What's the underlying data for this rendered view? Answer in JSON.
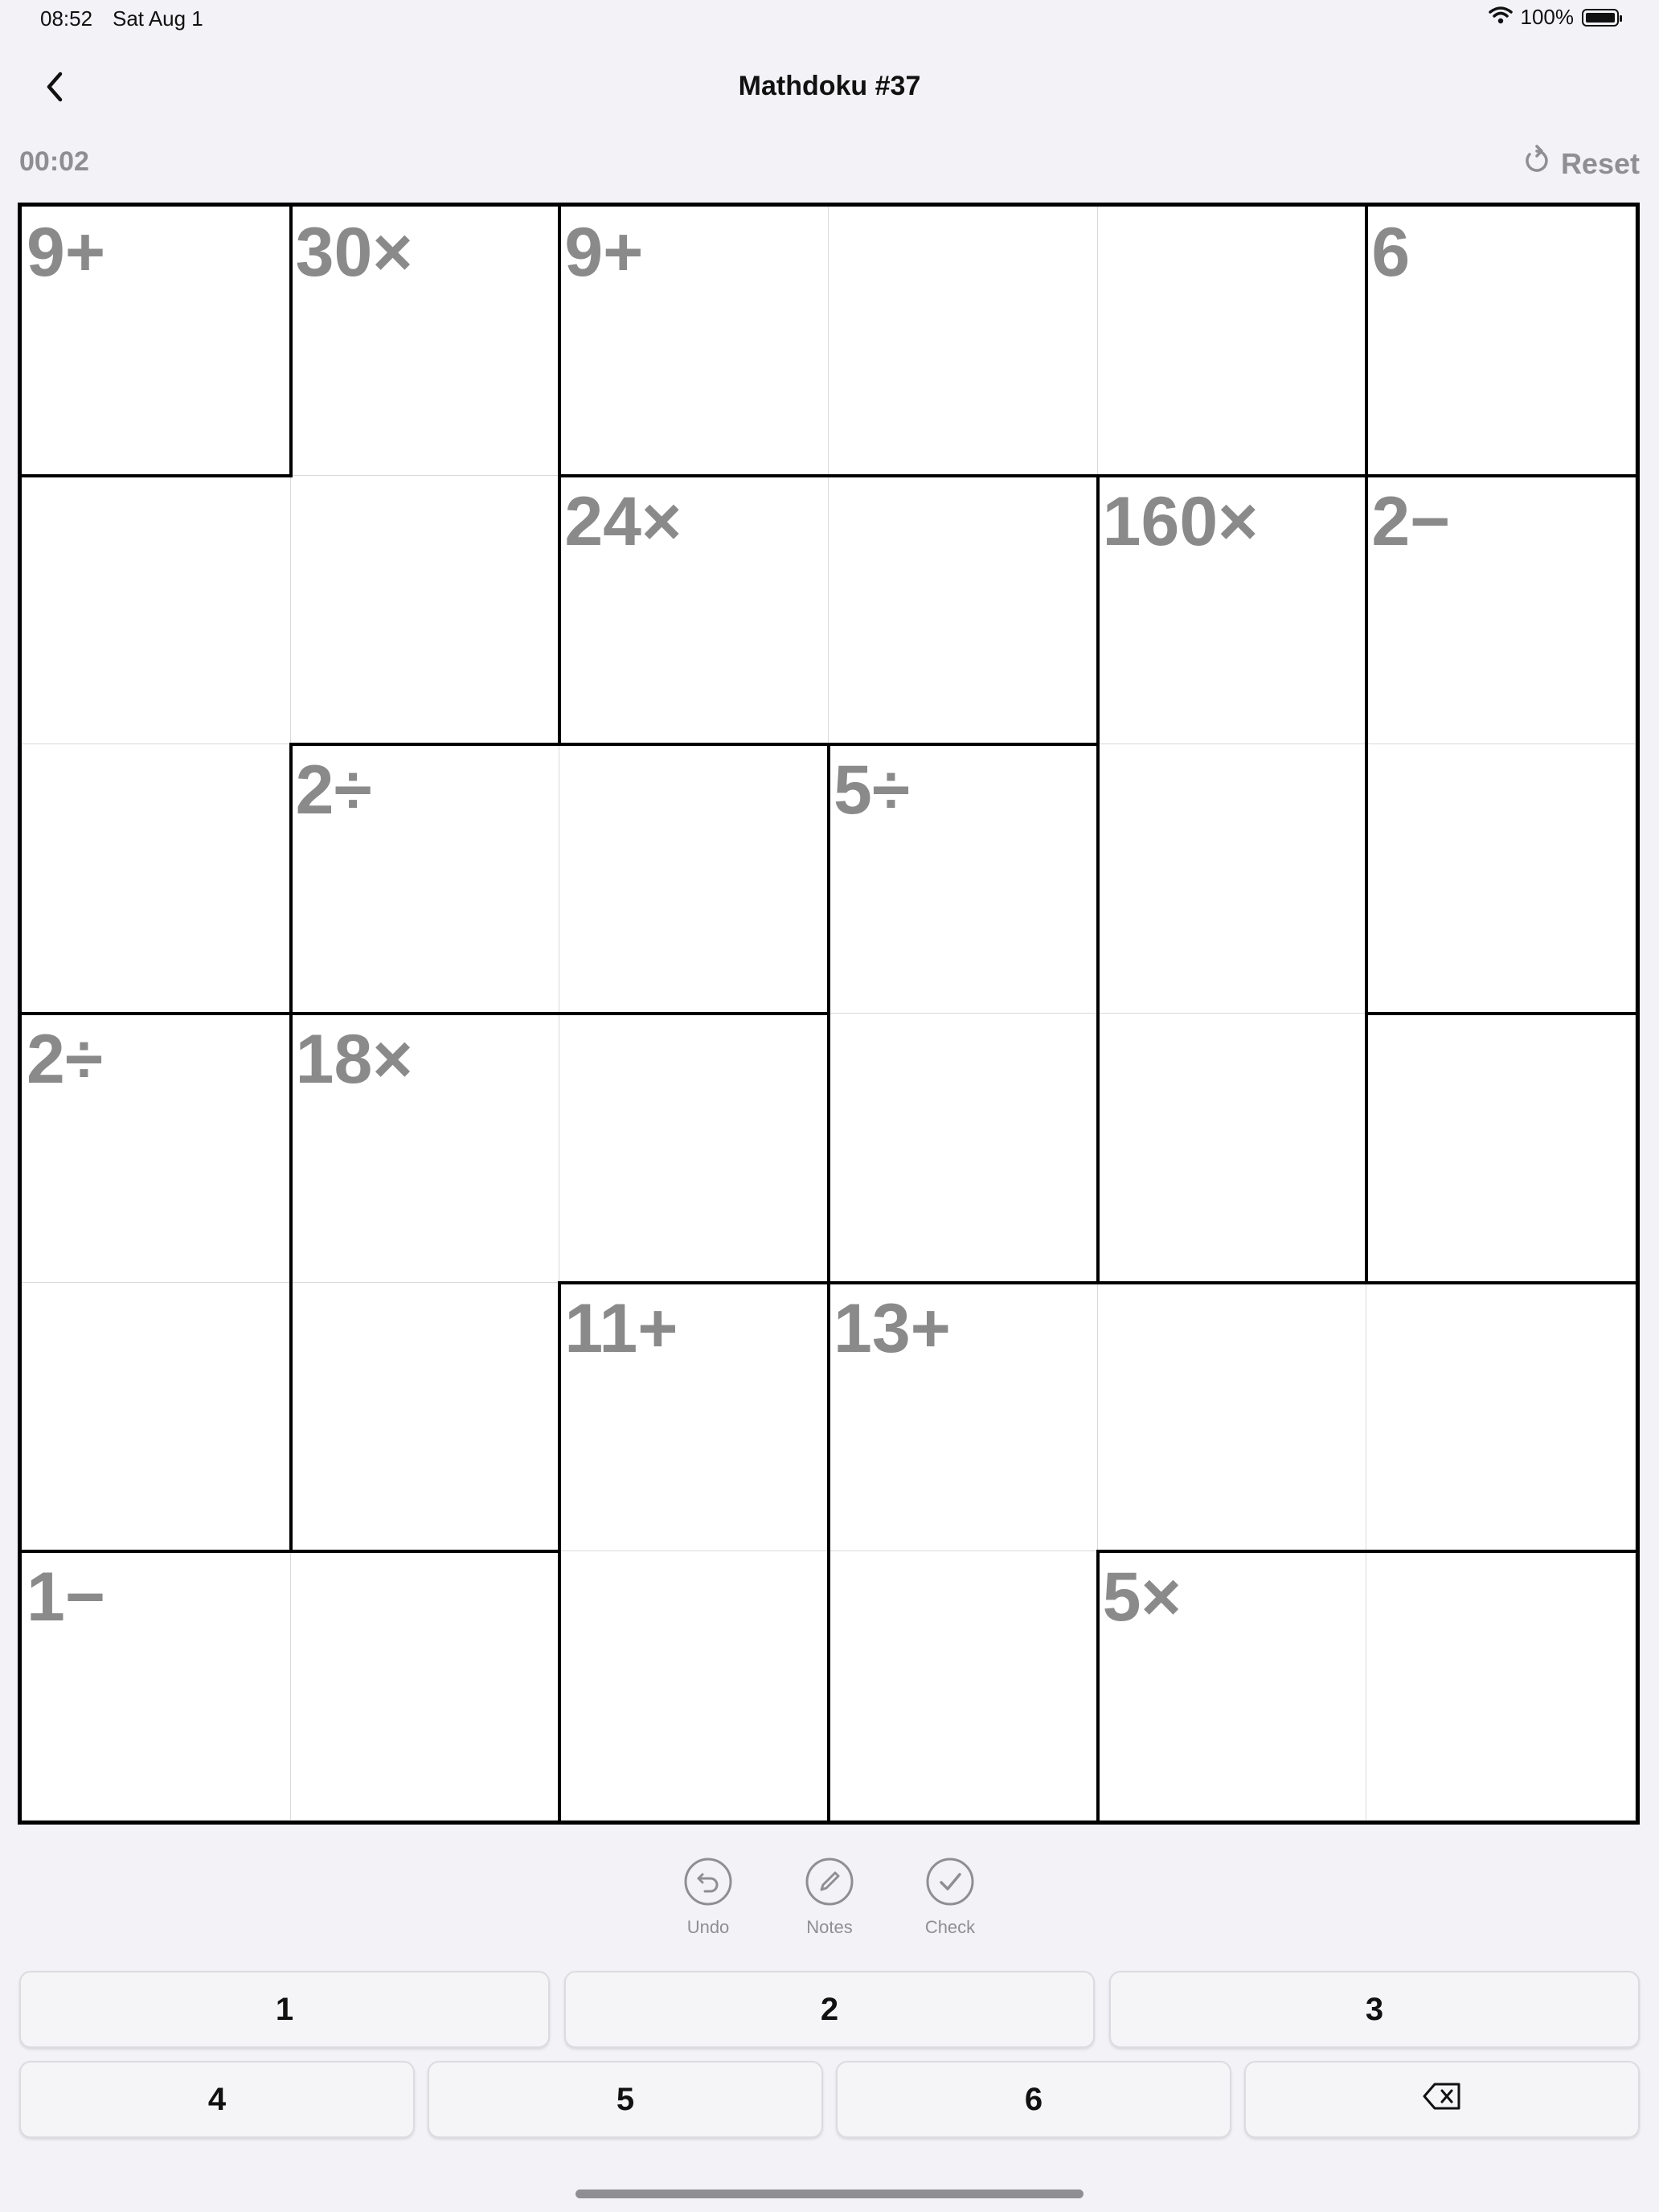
{
  "status_bar": {
    "time": "08:52",
    "date": "Sat Aug 1",
    "battery": "100%"
  },
  "nav": {
    "title": "Mathdoku #37",
    "back_icon": "chevron-left-icon"
  },
  "timer": "00:02",
  "reset_label": "Reset",
  "puzzle": {
    "size": 6,
    "cages": [
      {
        "label": "9+",
        "cells": [
          [
            0,
            0
          ],
          [
            0,
            1
          ]
        ]
      },
      {
        "label": "9+",
        "cells": [
          [
            0,
            2
          ],
          [
            0,
            3
          ],
          [
            0,
            4
          ]
        ]
      },
      {
        "label": "6",
        "cells": [
          [
            0,
            5
          ]
        ]
      },
      {
        "label": "30×",
        "cells": [
          [
            1,
            0
          ],
          [
            2,
            0
          ],
          [
            0,
            1
          ],
          [
            1,
            1
          ]
        ]
      },
      {
        "label": "24×",
        "cells": [
          [
            1,
            2
          ],
          [
            1,
            3
          ]
        ]
      },
      {
        "label": "160×",
        "cells": [
          [
            1,
            4
          ],
          [
            2,
            4
          ],
          [
            3,
            4
          ]
        ]
      },
      {
        "label": "2−",
        "cells": [
          [
            1,
            5
          ],
          [
            2,
            5
          ]
        ]
      },
      {
        "label": "2÷",
        "cells": [
          [
            2,
            1
          ],
          [
            2,
            2
          ]
        ]
      },
      {
        "label": "5÷",
        "cells": [
          [
            2,
            3
          ],
          [
            3,
            3
          ]
        ]
      },
      {
        "label": "2÷",
        "cells": [
          [
            3,
            0
          ],
          [
            4,
            0
          ]
        ]
      },
      {
        "label": "18×",
        "cells": [
          [
            3,
            1
          ],
          [
            3,
            2
          ],
          [
            4,
            1
          ]
        ]
      },
      {
        "label": "11+",
        "cells": [
          [
            4,
            2
          ],
          [
            5,
            2
          ]
        ]
      },
      {
        "label": "13+",
        "cells": [
          [
            4,
            3
          ],
          [
            4,
            4
          ],
          [
            4,
            5
          ],
          [
            5,
            3
          ]
        ]
      },
      {
        "label": "1−",
        "cells": [
          [
            5,
            0
          ],
          [
            5,
            1
          ]
        ]
      },
      {
        "label": "5×",
        "cells": [
          [
            5,
            4
          ],
          [
            5,
            5
          ]
        ]
      }
    ]
  },
  "tools": [
    {
      "label": "Undo",
      "icon": "undo-icon"
    },
    {
      "label": "Notes",
      "icon": "pencil-icon"
    },
    {
      "label": "Check",
      "icon": "checkmark-icon"
    }
  ],
  "keypad": {
    "row1": [
      "1",
      "2",
      "3"
    ],
    "row2": [
      "4",
      "5",
      "6"
    ],
    "delete_icon": "backspace-icon"
  }
}
